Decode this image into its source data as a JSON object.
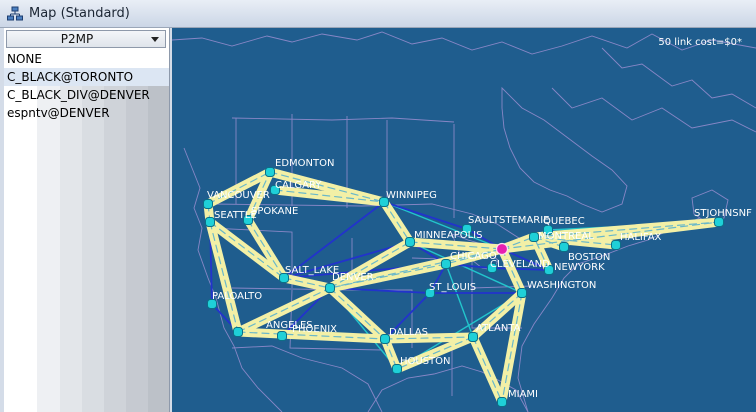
{
  "window": {
    "title": "Map (Standard)",
    "icon": "network-map-icon"
  },
  "left_panel": {
    "combo": {
      "value": "P2MP"
    },
    "items": [
      "NONE",
      "C_BLACK@TORONTO",
      "C_BLACK_DIV@DENVER",
      "espntv@DENVER"
    ],
    "selected_index": 1
  },
  "map": {
    "cost_label": "50 link cost=$0*",
    "colors": {
      "background": "#1f5d8e",
      "path": "#f3f0a6",
      "link_blue": "#2233cc",
      "link_cyan": "#22c5cc",
      "node": "#1fd0d8",
      "highlight": "#e81fb0"
    },
    "cities": [
      "EDMONTON",
      "CALGARY",
      "VANCOUVER",
      "SEATTLE",
      "SPOKANE",
      "WINNIPEG",
      "SAULTSTEMARIE",
      "QUEBEC",
      "STJOHNSNF",
      "MONTREAL",
      "HALIFAX",
      "BOSTON",
      "NEWYORK",
      "CLEVELAND",
      "TORONTO",
      "MINNEAPOLIS",
      "CHICAGO",
      "SALT_LAKE",
      "DENVER",
      "ST_LOUIS",
      "WASHINGTON",
      "PALOALTO",
      "LOSANGELES",
      "PHOENIX",
      "DALLAS",
      "ATLANTA",
      "HOUSTON",
      "MIAMI"
    ],
    "labels": [
      "EDMONTON",
      "CALGARY",
      "VANCOUVER",
      "SEATTLE",
      "SPOKANE",
      "WINNIPEG",
      "SAULTSTEMARIE",
      "QUEBEC",
      "STJOHNSNF",
      "MONTREAL",
      "HALIFAX",
      "BOSTON",
      "NEWYORK",
      "CLEVELAND",
      "MINNEAPOLIS",
      "CHICAGO",
      "SALT_LAKE",
      "DENVER",
      "ST_LOUIS",
      "WASHINGTON",
      "PALOALTO",
      "ANGELES",
      "PHOENIX",
      "DALLAS",
      "ATLANTA",
      "HOUSTON",
      "MIAMI"
    ]
  }
}
